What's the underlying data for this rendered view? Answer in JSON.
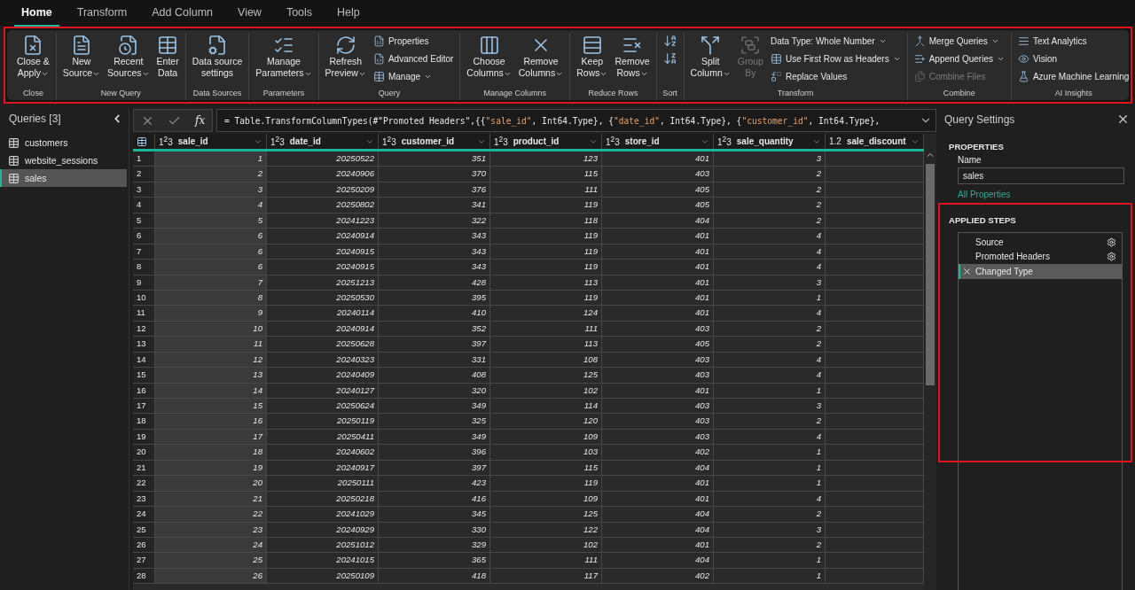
{
  "tabs": [
    {
      "label": "Home",
      "selected": true
    },
    {
      "label": "Transform",
      "selected": false
    },
    {
      "label": "Add Column",
      "selected": false
    },
    {
      "label": "View",
      "selected": false
    },
    {
      "label": "Tools",
      "selected": false
    },
    {
      "label": "Help",
      "selected": false
    }
  ],
  "ribbon": {
    "groups": [
      {
        "label": "Close",
        "columns": [
          [
            {
              "kind": "large",
              "lines": [
                "Close &",
                "Apply"
              ],
              "dropdown": true,
              "disabled": false
            }
          ]
        ]
      },
      {
        "label": "New Query",
        "columns": [
          [
            {
              "kind": "large",
              "lines": [
                "New",
                "Source"
              ],
              "dropdown": true,
              "disabled": false
            }
          ],
          [
            {
              "kind": "large",
              "lines": [
                "Recent",
                "Sources"
              ],
              "dropdown": true,
              "disabled": false
            }
          ],
          [
            {
              "kind": "large",
              "lines": [
                "Enter",
                "Data"
              ],
              "dropdown": false,
              "disabled": false
            }
          ]
        ]
      },
      {
        "label": "Data Sources",
        "columns": [
          [
            {
              "kind": "large",
              "lines": [
                "Data source",
                "settings"
              ],
              "dropdown": false,
              "disabled": false
            }
          ]
        ]
      },
      {
        "label": "Parameters",
        "columns": [
          [
            {
              "kind": "large",
              "lines": [
                "Manage",
                "Parameters"
              ],
              "dropdown": true,
              "disabled": false
            }
          ]
        ]
      },
      {
        "label": "Query",
        "columns": [
          [
            {
              "kind": "large",
              "lines": [
                "Refresh",
                "Preview"
              ],
              "dropdown": true,
              "disabled": false
            }
          ],
          [
            {
              "kind": "small",
              "lines": [
                "Properties"
              ],
              "dropdown": false,
              "disabled": false
            },
            {
              "kind": "small",
              "lines": [
                "Advanced Editor"
              ],
              "dropdown": false,
              "disabled": false
            },
            {
              "kind": "small",
              "lines": [
                "Manage"
              ],
              "dropdown": true,
              "disabled": false
            }
          ]
        ]
      },
      {
        "label": "Manage Columns",
        "columns": [
          [
            {
              "kind": "large",
              "lines": [
                "Choose",
                "Columns"
              ],
              "dropdown": true,
              "disabled": false
            }
          ],
          [
            {
              "kind": "large",
              "lines": [
                "Remove",
                "Columns"
              ],
              "dropdown": true,
              "disabled": false
            }
          ]
        ]
      },
      {
        "label": "Reduce Rows",
        "columns": [
          [
            {
              "kind": "large",
              "lines": [
                "Keep",
                "Rows"
              ],
              "dropdown": true,
              "disabled": false
            }
          ],
          [
            {
              "kind": "large",
              "lines": [
                "Remove",
                "Rows"
              ],
              "dropdown": true,
              "disabled": false
            }
          ]
        ]
      },
      {
        "label": "Sort",
        "columns": [
          [
            {
              "kind": "icon",
              "dropdown": false,
              "disabled": false
            },
            {
              "kind": "icon",
              "dropdown": false,
              "disabled": false
            }
          ]
        ]
      },
      {
        "label": "Transform",
        "columns": [
          [
            {
              "kind": "large",
              "lines": [
                "Split",
                "Column"
              ],
              "dropdown": true,
              "disabled": false
            }
          ],
          [
            {
              "kind": "large",
              "lines": [
                "Group",
                "By"
              ],
              "dropdown": false,
              "disabled": true
            }
          ],
          [
            {
              "kind": "small",
              "lines": [
                "Data Type: Whole Number"
              ],
              "dropdown": true,
              "disabled": false
            },
            {
              "kind": "small",
              "lines": [
                "Use First Row as Headers"
              ],
              "dropdown": true,
              "disabled": false
            },
            {
              "kind": "small",
              "lines": [
                "Replace Values"
              ],
              "dropdown": false,
              "disabled": false
            }
          ]
        ]
      },
      {
        "label": "Combine",
        "columns": [
          [
            {
              "kind": "small",
              "lines": [
                "Merge Queries"
              ],
              "dropdown": true,
              "disabled": false
            },
            {
              "kind": "small",
              "lines": [
                "Append Queries"
              ],
              "dropdown": true,
              "disabled": false
            },
            {
              "kind": "small",
              "lines": [
                "Combine Files"
              ],
              "dropdown": false,
              "disabled": true
            }
          ]
        ]
      },
      {
        "label": "AI Insights",
        "columns": [
          [
            {
              "kind": "small",
              "lines": [
                "Text Analytics"
              ],
              "dropdown": false,
              "disabled": false
            },
            {
              "kind": "small",
              "lines": [
                "Vision"
              ],
              "dropdown": false,
              "disabled": false
            },
            {
              "kind": "small",
              "lines": [
                "Azure Machine Learning"
              ],
              "dropdown": false,
              "disabled": false
            }
          ]
        ]
      }
    ]
  },
  "queries": {
    "title": "Queries [3]",
    "items": [
      {
        "label": "customers",
        "selected": false
      },
      {
        "label": "website_sessions",
        "selected": false
      },
      {
        "label": "sales",
        "selected": true
      }
    ]
  },
  "formula": {
    "fx": "fx",
    "segments": [
      {
        "kind": "code",
        "text": "= Table.TransformColumnTypes(#\"Promoted Headers\",{{"
      },
      {
        "kind": "string",
        "text": "\"sale_id\""
      },
      {
        "kind": "code",
        "text": ", Int64.Type}, {"
      },
      {
        "kind": "string",
        "text": "\"date_id\""
      },
      {
        "kind": "code",
        "text": ", Int64.Type}, {"
      },
      {
        "kind": "string",
        "text": "\"customer_id\""
      },
      {
        "kind": "code",
        "text": ", Int64.Type},"
      }
    ]
  },
  "table": {
    "columns": [
      {
        "type": "1$^{2}$3",
        "name": "sale_id"
      },
      {
        "type": "1$^{2}$3",
        "name": "date_id"
      },
      {
        "type": "1$^{2}$3",
        "name": "customer_id"
      },
      {
        "type": "1$^{2}$3",
        "name": "product_id"
      },
      {
        "type": "1$^{2}$3",
        "name": "store_id"
      },
      {
        "type": "1$^{2}$3",
        "name": "sale_quantity"
      },
      {
        "type": "1.2",
        "name": "sale_discount"
      }
    ],
    "rows": [
      [
        "1",
        "1",
        "20250522",
        "351",
        "123",
        "401",
        "3"
      ],
      [
        "2",
        "2",
        "20240906",
        "370",
        "115",
        "403",
        "2"
      ],
      [
        "3",
        "3",
        "20250209",
        "376",
        "111",
        "405",
        "2"
      ],
      [
        "4",
        "4",
        "20250802",
        "341",
        "119",
        "405",
        "2"
      ],
      [
        "5",
        "5",
        "20241223",
        "322",
        "118",
        "404",
        "2"
      ],
      [
        "6",
        "6",
        "20240914",
        "343",
        "119",
        "401",
        "4"
      ],
      [
        "7",
        "6",
        "20240915",
        "343",
        "119",
        "401",
        "4"
      ],
      [
        "8",
        "6",
        "20240915",
        "343",
        "119",
        "401",
        "4"
      ],
      [
        "9",
        "7",
        "20251213",
        "428",
        "113",
        "401",
        "3"
      ],
      [
        "10",
        "8",
        "20250530",
        "395",
        "119",
        "401",
        "1"
      ],
      [
        "11",
        "9",
        "20240114",
        "410",
        "124",
        "401",
        "4"
      ],
      [
        "12",
        "10",
        "20240914",
        "352",
        "111",
        "403",
        "2"
      ],
      [
        "13",
        "11",
        "20250628",
        "397",
        "113",
        "405",
        "2"
      ],
      [
        "14",
        "12",
        "20240323",
        "331",
        "108",
        "403",
        "4"
      ],
      [
        "15",
        "13",
        "20240409",
        "408",
        "125",
        "403",
        "4"
      ],
      [
        "16",
        "14",
        "20240127",
        "320",
        "102",
        "401",
        "1"
      ],
      [
        "17",
        "15",
        "20250624",
        "349",
        "114",
        "403",
        "3"
      ],
      [
        "18",
        "16",
        "20250119",
        "325",
        "120",
        "403",
        "2"
      ],
      [
        "19",
        "17",
        "20250411",
        "349",
        "109",
        "403",
        "4"
      ],
      [
        "20",
        "18",
        "20240602",
        "396",
        "103",
        "402",
        "1"
      ],
      [
        "21",
        "19",
        "20240917",
        "397",
        "115",
        "404",
        "1"
      ],
      [
        "22",
        "20",
        "20250111",
        "423",
        "119",
        "401",
        "1"
      ],
      [
        "23",
        "21",
        "20250218",
        "416",
        "109",
        "401",
        "4"
      ],
      [
        "24",
        "22",
        "20241029",
        "345",
        "125",
        "404",
        "2"
      ],
      [
        "25",
        "23",
        "20240929",
        "330",
        "122",
        "404",
        "3"
      ],
      [
        "26",
        "24",
        "20251012",
        "329",
        "102",
        "401",
        "2"
      ],
      [
        "27",
        "25",
        "20241015",
        "365",
        "111",
        "404",
        "1"
      ],
      [
        "28",
        "26",
        "20250109",
        "418",
        "117",
        "402",
        "1"
      ]
    ]
  },
  "settings": {
    "title": "Query Settings",
    "properties_heading": "PROPERTIES",
    "name_label": "Name",
    "name_value": "sales",
    "all_properties": "All Properties",
    "steps_heading": "APPLIED STEPS",
    "steps": [
      {
        "label": "Source",
        "selected": false,
        "has_settings": true
      },
      {
        "label": "Promoted Headers",
        "selected": false,
        "has_settings": true
      },
      {
        "label": "Changed Type",
        "selected": true,
        "has_settings": false
      }
    ]
  }
}
